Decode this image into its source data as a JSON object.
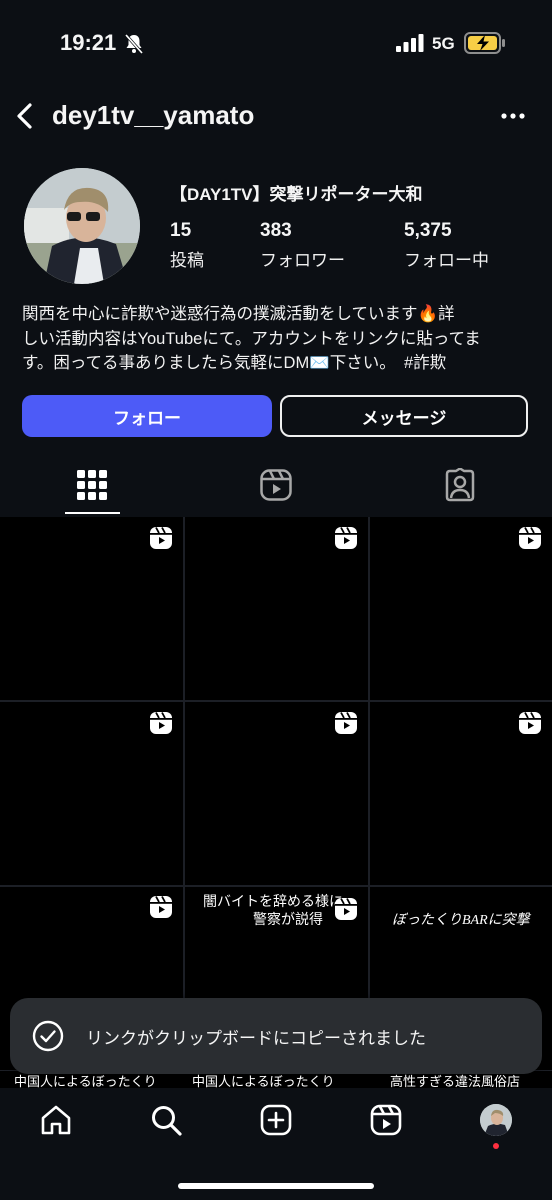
{
  "status_bar": {
    "time": "19:21",
    "network": "5G",
    "icons": [
      "bell-slash-icon",
      "signal-icon",
      "battery-charging-icon"
    ]
  },
  "header": {
    "username": "dey1tv__yamato",
    "icons": [
      "back-chevron-icon",
      "more-dots-icon"
    ]
  },
  "profile": {
    "display_name": "【DAY1TV】突撃リポーター大和",
    "stats": [
      {
        "value": "15",
        "label": "投稿"
      },
      {
        "value": "383",
        "label": "フォロワー"
      },
      {
        "value": "5,375",
        "label": "フォロー中"
      }
    ],
    "bio_lines": [
      "関西を中心に詐欺や迷惑行為の撲滅活動をしています🔥詳",
      "しい活動内容はYouTubeにて。アカウントをリンクに貼ってま",
      "す。困ってる事ありましたら気軽にDM✉️下さい。　#詐欺"
    ]
  },
  "actions": {
    "follow_label": "フォロー",
    "message_label": "メッセージ",
    "follow_color": "#4d5bf7"
  },
  "tabs": {
    "items": [
      "grid-icon",
      "reels-icon",
      "tagged-icon"
    ],
    "active": "grid-icon"
  },
  "grid": {
    "captions": {
      "c8_line1": "闇バイトを辞める様に",
      "c8_line2": "警察が説得",
      "c9": "ぼったくりBARに突撃",
      "c10": "中国人によるぼったくり",
      "c11": "中国人によるぼったくり",
      "c12": "高性すぎる違法風俗店"
    }
  },
  "toast": {
    "message": "リンクがクリップボードにコピーされました",
    "icon": "check-circle-icon"
  },
  "bottom_nav": {
    "items": [
      "home-icon",
      "search-icon",
      "create-icon",
      "reels-icon",
      "profile-avatar"
    ],
    "notification_color": "#ff3040"
  }
}
